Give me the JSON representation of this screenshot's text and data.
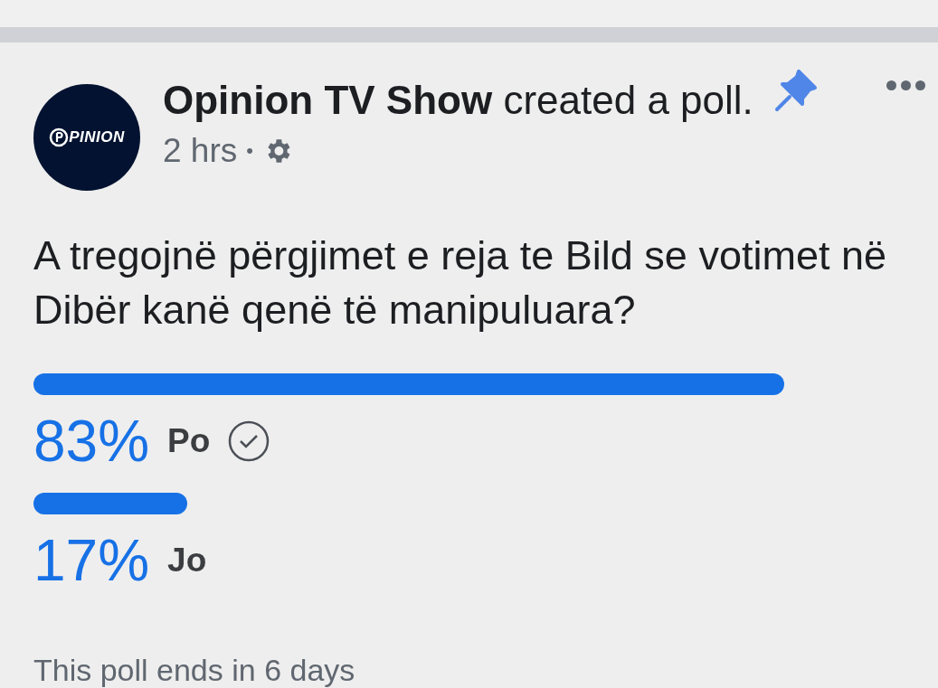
{
  "post": {
    "avatar_text": "PINION",
    "author": "Opinion TV Show",
    "action": "created a poll.",
    "pinned": true,
    "time": "2 hrs",
    "separator": "•"
  },
  "question": "A tregojnë përgjimet e reja te Bild se votimet në Dibër kanë qenë të manipuluara?",
  "options": [
    {
      "percent": "83%",
      "label": "Po",
      "selected": true
    },
    {
      "percent": "17%",
      "label": "Jo",
      "selected": false
    }
  ],
  "footer": "This poll ends in 6 days"
}
